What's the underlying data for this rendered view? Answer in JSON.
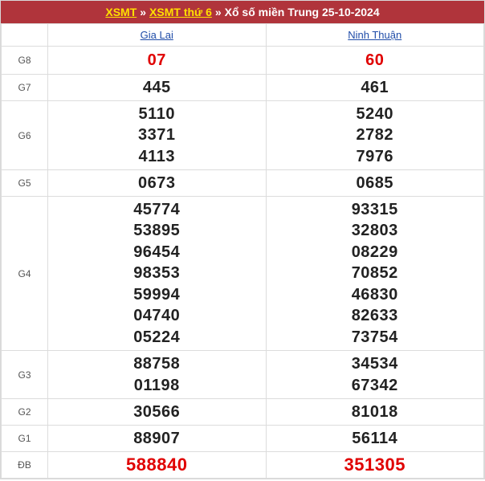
{
  "header": {
    "link1": "XSMT",
    "sep1": "»",
    "link2": "XSMT thứ 6",
    "sep2": "»",
    "title": "Xổ số miền Trung 25-10-2024"
  },
  "provinces": [
    "Gia Lai",
    "Ninh Thuận"
  ],
  "prizes": [
    {
      "label": "G8",
      "cols": [
        [
          "07"
        ],
        [
          "60"
        ]
      ]
    },
    {
      "label": "G7",
      "cols": [
        [
          "445"
        ],
        [
          "461"
        ]
      ]
    },
    {
      "label": "G6",
      "cols": [
        [
          "5110",
          "3371",
          "4113"
        ],
        [
          "5240",
          "2782",
          "7976"
        ]
      ]
    },
    {
      "label": "G5",
      "cols": [
        [
          "0673"
        ],
        [
          "0685"
        ]
      ]
    },
    {
      "label": "G4",
      "cols": [
        [
          "45774",
          "53895",
          "96454",
          "98353",
          "59994",
          "04740",
          "05224"
        ],
        [
          "93315",
          "32803",
          "08229",
          "70852",
          "46830",
          "82633",
          "73754"
        ]
      ]
    },
    {
      "label": "G3",
      "cols": [
        [
          "88758",
          "01198"
        ],
        [
          "34534",
          "67342"
        ]
      ]
    },
    {
      "label": "G2",
      "cols": [
        [
          "30566"
        ],
        [
          "81018"
        ]
      ]
    },
    {
      "label": "G1",
      "cols": [
        [
          "88907"
        ],
        [
          "56114"
        ]
      ]
    },
    {
      "label": "ĐB",
      "cols": [
        [
          "588840"
        ],
        [
          "351305"
        ]
      ]
    }
  ],
  "colors": {
    "header_bg": "#b0343b",
    "header_link": "#ffe000",
    "highlight_red": "#e00000",
    "province_link": "#1f4ca8"
  }
}
